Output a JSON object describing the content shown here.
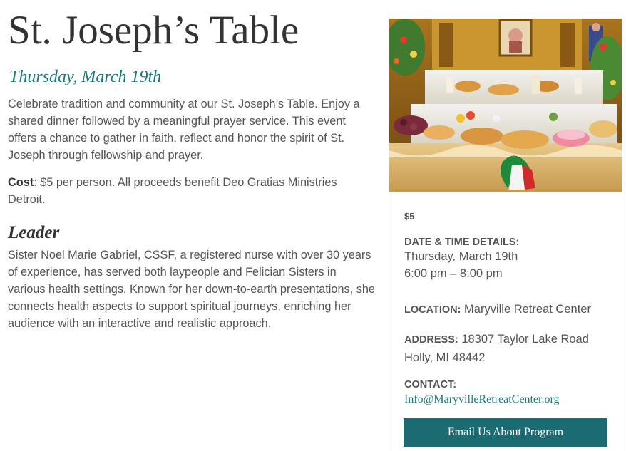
{
  "event": {
    "title": "St. Joseph’s Table",
    "date_heading": "Thursday, March 19th",
    "description": "Celebrate tradition and community at our St. Joseph’s Table. Enjoy a shared dinner followed by a meaningful prayer service. This event offers a chance to gather in faith, reflect and honor the spirit of St. Joseph through fellowship and prayer.",
    "cost_label": "Cost",
    "cost_text": ": $5 per person. All proceeds benefit Deo Gratias Ministries Detroit.",
    "leader_heading": "Leader",
    "leader_bio": "Sister Noel Marie Gabriel, CSSF, a registered nurse with over 30 years of experience, has served both laypeople and Felician Sisters in various health settings. Known for her down-to-earth presentations, she connects health aspects to support spiritual journeys, enriching her audience with an interactive and realistic approach."
  },
  "sidebar": {
    "price": "$5",
    "datetime_label": "DATE & TIME DETAILS:",
    "date": "Thursday, March 19th",
    "time": "6:00 pm – 8:00 pm",
    "location_label": "LOCATION:",
    "location": " Maryville Retreat Center",
    "address_label": "ADDRESS:",
    "address_line1": " 18307 Taylor Lake Road",
    "address_line2": "Holly, MI 48442",
    "contact_label": "CONTACT:",
    "contact_email": "Info@MaryvilleRetreatCenter.org",
    "button_label": "Email Us About Program"
  },
  "colors": {
    "accent": "#1e7a7a",
    "button": "#1b6b73",
    "text": "#555555",
    "heading": "#333333"
  }
}
